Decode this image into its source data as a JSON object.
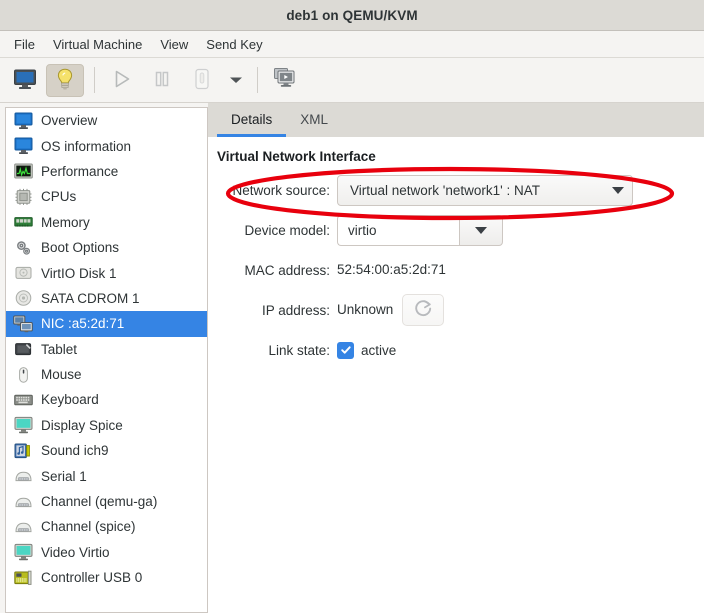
{
  "window": {
    "title": "deb1 on QEMU/KVM"
  },
  "menubar": {
    "items": [
      {
        "label": "File",
        "name": "menu-file"
      },
      {
        "label": "Virtual Machine",
        "name": "menu-virtual-machine"
      },
      {
        "label": "View",
        "name": "menu-view"
      },
      {
        "label": "Send Key",
        "name": "menu-send-key"
      }
    ]
  },
  "toolbar": {
    "buttons": [
      {
        "name": "show-console-button",
        "icon": "monitor-icon",
        "state": "enabled"
      },
      {
        "name": "show-details-button",
        "icon": "lightbulb-icon",
        "state": "active"
      },
      {
        "name": "run-button",
        "icon": "play-icon",
        "state": "disabled"
      },
      {
        "name": "pause-button",
        "icon": "pause-icon",
        "state": "disabled"
      },
      {
        "name": "shutdown-button",
        "icon": "power-icon",
        "state": "disabled"
      },
      {
        "name": "shutdown-menu-button",
        "icon": "chevron-down-icon",
        "state": "enabled"
      },
      {
        "name": "snapshots-button",
        "icon": "screens-icon",
        "state": "enabled"
      }
    ]
  },
  "sidebar": {
    "items": [
      {
        "label": "Overview",
        "icon": "monitor-icon",
        "selected": false
      },
      {
        "label": "OS information",
        "icon": "monitor-icon",
        "selected": false
      },
      {
        "label": "Performance",
        "icon": "performance-graph-icon",
        "selected": false
      },
      {
        "label": "CPUs",
        "icon": "cpu-chip-icon",
        "selected": false
      },
      {
        "label": "Memory",
        "icon": "memory-stick-icon",
        "selected": false
      },
      {
        "label": "Boot Options",
        "icon": "gears-icon",
        "selected": false
      },
      {
        "label": "VirtIO Disk 1",
        "icon": "hard-disk-icon",
        "selected": false
      },
      {
        "label": "SATA CDROM 1",
        "icon": "optical-disc-icon",
        "selected": false
      },
      {
        "label": "NIC :a5:2d:71",
        "icon": "network-card-icon",
        "selected": true
      },
      {
        "label": "Tablet",
        "icon": "tablet-icon",
        "selected": false
      },
      {
        "label": "Mouse",
        "icon": "mouse-icon",
        "selected": false
      },
      {
        "label": "Keyboard",
        "icon": "keyboard-icon",
        "selected": false
      },
      {
        "label": "Display Spice",
        "icon": "display-icon",
        "selected": false
      },
      {
        "label": "Sound ich9",
        "icon": "sound-icon",
        "selected": false
      },
      {
        "label": "Serial 1",
        "icon": "serial-port-icon",
        "selected": false
      },
      {
        "label": "Channel (qemu-ga)",
        "icon": "serial-port-icon",
        "selected": false
      },
      {
        "label": "Channel (spice)",
        "icon": "serial-port-icon",
        "selected": false
      },
      {
        "label": "Video Virtio",
        "icon": "display-icon",
        "selected": false
      },
      {
        "label": "Controller USB 0",
        "icon": "controller-card-icon",
        "selected": false
      }
    ]
  },
  "main": {
    "tabs": [
      {
        "label": "Details",
        "active": true
      },
      {
        "label": "XML",
        "active": false
      }
    ],
    "section_title": "Virtual Network Interface",
    "fields": {
      "network_source": {
        "label": "Network source:",
        "value": "Virtual network 'network1' : NAT"
      },
      "device_model": {
        "label": "Device model:",
        "value": "virtio"
      },
      "mac_address": {
        "label": "MAC address:",
        "value": "52:54:00:a5:2d:71"
      },
      "ip_address": {
        "label": "IP address:",
        "value": "Unknown",
        "refresh_icon": "refresh-icon"
      },
      "link_state": {
        "label": "Link state:",
        "checkbox_label": "active",
        "checked": true
      }
    }
  },
  "annotation": {
    "shape": "ellipse",
    "color": "#e8000d",
    "target": "network-source-row"
  },
  "colors": {
    "titlebar": "#dcdad5",
    "chrome": "#f5f4f2",
    "selection": "#3584e4",
    "text": "#2e3436",
    "annotation": "#e8000d"
  }
}
